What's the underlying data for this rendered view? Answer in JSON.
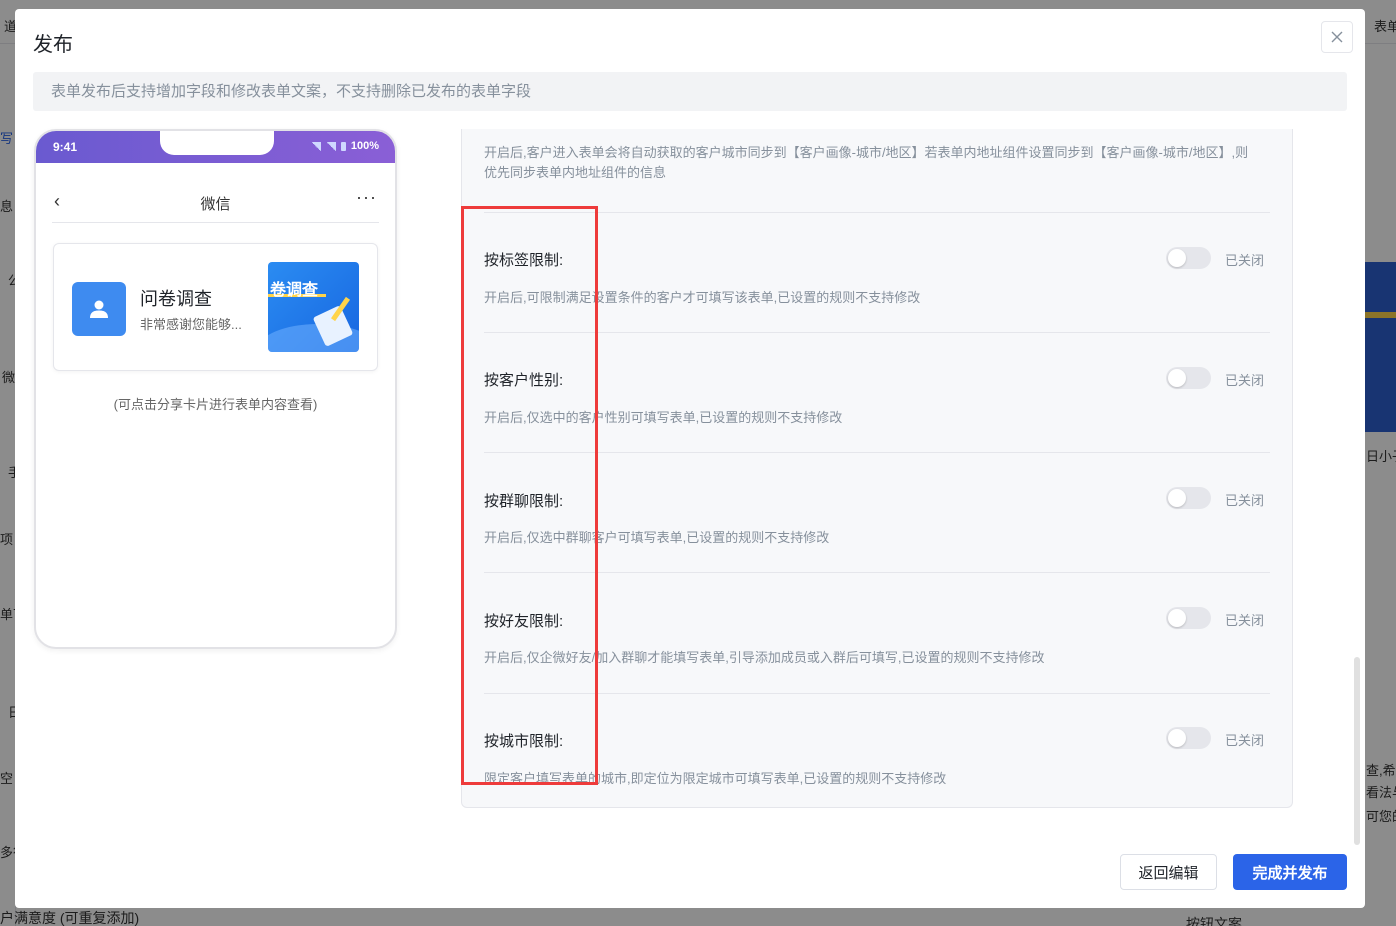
{
  "background": {
    "top_left_text": "道",
    "top_right_text": "表单",
    "left_fragments": [
      "写",
      "息 (",
      "公",
      "微",
      "手",
      "项 (",
      "单下",
      "日",
      "空",
      "多行"
    ],
    "bottom_left_text": "户满意度 (可重复添加)",
    "right_fragments": [
      "日小子",
      "查,希望",
      "看法与",
      "可您的"
    ],
    "bottom_right_text": "按钮文案"
  },
  "modal": {
    "title": "发布",
    "close_icon": "close-icon",
    "notice": "表单发布后支持增加字段和修改表单文案，不支持删除已发布的表单字段"
  },
  "phone": {
    "time": "9:41",
    "battery": "100%",
    "nav_title": "微信",
    "nav_back": "‹",
    "nav_more": "···",
    "card": {
      "title": "问卷调查",
      "desc": "非常感谢您能够...",
      "image_text": "卷调查"
    },
    "hint": "(可点击分享卡片进行表单内容查看)"
  },
  "panel": {
    "top_desc": "开启后,客户进入表单会将自动获取的客户城市同步到【客户画像-城市/地区】若表单内地址组件设置同步到【客户画像-城市/地区】,则优先同步表单内地址组件的信息",
    "settings": [
      {
        "label": "按标签限制:",
        "desc": "开启后,可限制满足设置条件的客户才可填写该表单,已设置的规则不支持修改",
        "enabled": false,
        "status": "已关闭"
      },
      {
        "label": "按客户性别:",
        "desc": "开启后,仅选中的客户性别可填写表单,已设置的规则不支持修改",
        "enabled": false,
        "status": "已关闭"
      },
      {
        "label": "按群聊限制:",
        "desc": "开启后,仅选中群聊客户可填写表单,已设置的规则不支持修改",
        "enabled": false,
        "status": "已关闭"
      },
      {
        "label": "按好友限制:",
        "desc": "开启后,仅企微好友/加入群聊才能填写表单,引导添加成员或入群后可填写,已设置的规则不支持修改",
        "enabled": false,
        "status": "已关闭"
      },
      {
        "label": "按城市限制:",
        "desc": "限定客户填写表单的城市,即定位为限定城市可填写表单,已设置的规则不支持修改",
        "enabled": false,
        "status": "已关闭"
      }
    ]
  },
  "footer": {
    "back_label": "返回编辑",
    "publish_label": "完成并发布"
  },
  "colors": {
    "primary": "#2b64e8",
    "highlight": "#ee3b3b",
    "muted_text": "#86909c"
  }
}
